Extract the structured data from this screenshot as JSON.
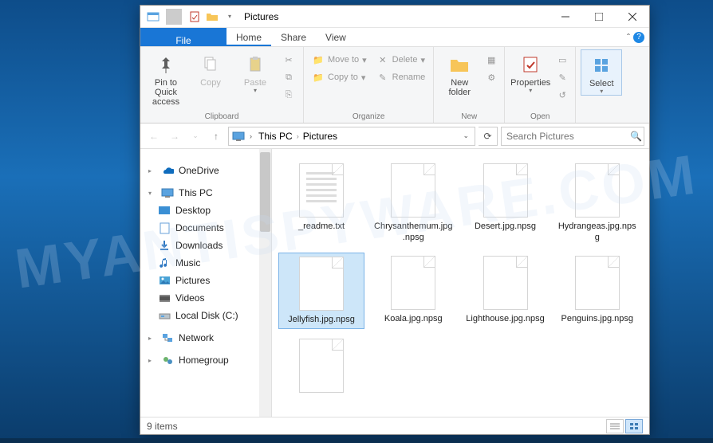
{
  "watermark": "MYANTISPYWARE.COM",
  "window": {
    "title": "Pictures"
  },
  "tabs": {
    "file": "File",
    "home": "Home",
    "share": "Share",
    "view": "View"
  },
  "ribbon": {
    "clipboard": {
      "label": "Clipboard",
      "pin": "Pin to Quick access",
      "copy": "Copy",
      "paste": "Paste"
    },
    "organize": {
      "label": "Organize",
      "moveto": "Move to",
      "copyto": "Copy to",
      "delete": "Delete",
      "rename": "Rename"
    },
    "new": {
      "label": "New",
      "newfolder": "New folder"
    },
    "open": {
      "label": "Open",
      "properties": "Properties"
    },
    "select": {
      "label": "",
      "select": "Select"
    }
  },
  "breadcrumb": {
    "items": [
      "This PC",
      "Pictures"
    ]
  },
  "search": {
    "placeholder": "Search Pictures"
  },
  "sidebar": {
    "onedrive": "OneDrive",
    "thispc": "This PC",
    "desktop": "Desktop",
    "documents": "Documents",
    "downloads": "Downloads",
    "music": "Music",
    "pictures": "Pictures",
    "videos": "Videos",
    "localdisk": "Local Disk (C:)",
    "network": "Network",
    "homegroup": "Homegroup"
  },
  "files": [
    {
      "name": "_readme.txt",
      "type": "text",
      "selected": false
    },
    {
      "name": "Chrysanthemum.jpg.npsg",
      "type": "blank",
      "selected": false
    },
    {
      "name": "Desert.jpg.npsg",
      "type": "blank",
      "selected": false
    },
    {
      "name": "Hydrangeas.jpg.npsg",
      "type": "blank",
      "selected": false
    },
    {
      "name": "Jellyfish.jpg.npsg",
      "type": "blank",
      "selected": true
    },
    {
      "name": "Koala.jpg.npsg",
      "type": "blank",
      "selected": false
    },
    {
      "name": "Lighthouse.jpg.npsg",
      "type": "blank",
      "selected": false
    },
    {
      "name": "Penguins.jpg.npsg",
      "type": "blank",
      "selected": false
    },
    {
      "name": "",
      "type": "blank",
      "selected": false
    }
  ],
  "status": {
    "count": "9 items"
  }
}
